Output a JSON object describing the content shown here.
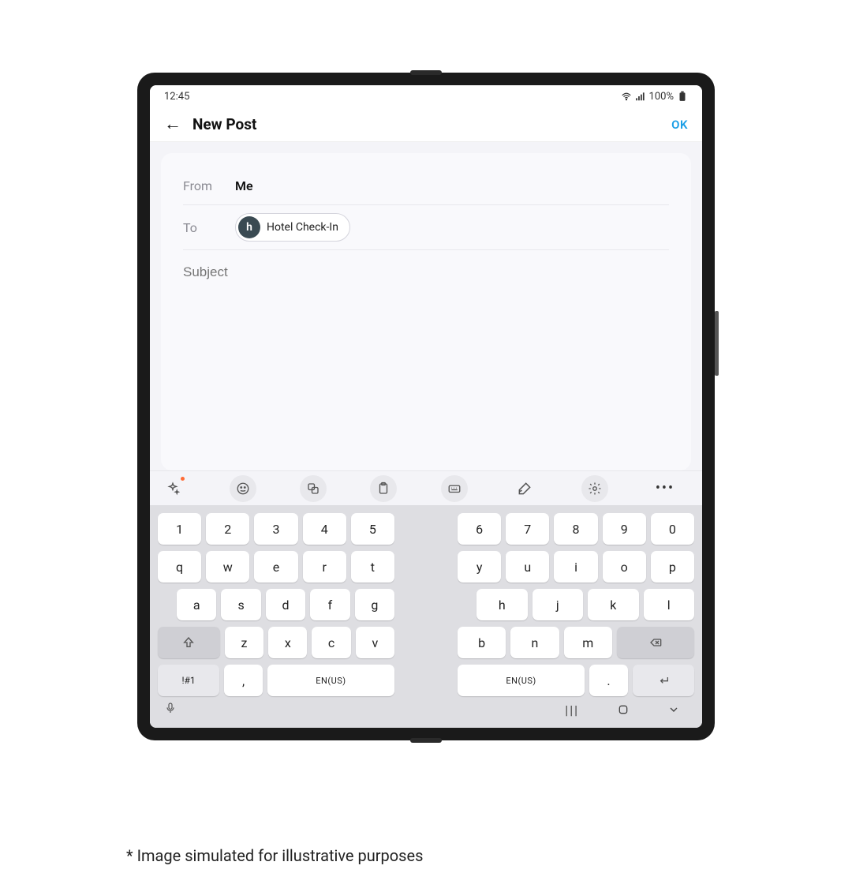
{
  "status": {
    "time": "12:45",
    "battery": "100%"
  },
  "header": {
    "title": "New Post",
    "ok": "OK"
  },
  "compose": {
    "from_label": "From",
    "from_value": "Me",
    "to_label": "To",
    "chip_initial": "h",
    "chip_text": "Hotel Check-In",
    "subject_placeholder": "Subject"
  },
  "keyboard": {
    "left_num": [
      "1",
      "2",
      "3",
      "4",
      "5"
    ],
    "right_num": [
      "6",
      "7",
      "8",
      "9",
      "0"
    ],
    "left_q": [
      "q",
      "w",
      "e",
      "r",
      "t"
    ],
    "right_q": [
      "y",
      "u",
      "i",
      "o",
      "p"
    ],
    "left_a": [
      "a",
      "s",
      "d",
      "f",
      "g"
    ],
    "right_a": [
      "h",
      "j",
      "k",
      "l"
    ],
    "left_z": [
      "z",
      "x",
      "c",
      "v"
    ],
    "right_z": [
      "b",
      "n",
      "m"
    ],
    "sym": "!#1",
    "comma": ",",
    "period": ".",
    "lang": "EN(US)"
  },
  "footnote": "* Image simulated for illustrative purposes"
}
